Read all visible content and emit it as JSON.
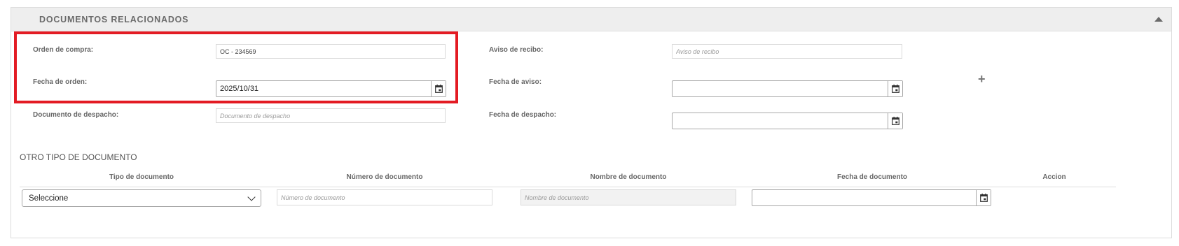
{
  "panel": {
    "title": "DOCUMENTOS RELACIONADOS",
    "collapse_icon": "chevron-up-icon"
  },
  "fields": {
    "orden_compra": {
      "label": "Orden de compra:",
      "value": "OC - 234569"
    },
    "fecha_orden": {
      "label": "Fecha de orden:",
      "value": "2025/10/31"
    },
    "documento_despacho": {
      "label": "Documento de despacho:",
      "placeholder": "Documento de despacho"
    },
    "aviso_recibo": {
      "label": "Aviso de recibo:",
      "placeholder": "Aviso de recibo"
    },
    "fecha_aviso": {
      "label": "Fecha de aviso:",
      "value": ""
    },
    "fecha_despacho": {
      "label": "Fecha de despacho:",
      "value": ""
    }
  },
  "add_icon": "plus-icon",
  "otro_tipo": {
    "title": "OTRO TIPO DE DOCUMENTO",
    "columns": [
      "Tipo de documento",
      "Número de documento",
      "Nombre de documento",
      "Fecha de documento",
      "Accion"
    ],
    "row": {
      "tipo_selected": "Seleccione",
      "numero_placeholder": "Número de documento",
      "nombre_placeholder": "Nombre de documento",
      "fecha_value": ""
    }
  },
  "colors": {
    "highlight": "#e31b23",
    "header_bg": "#eeeeee"
  }
}
